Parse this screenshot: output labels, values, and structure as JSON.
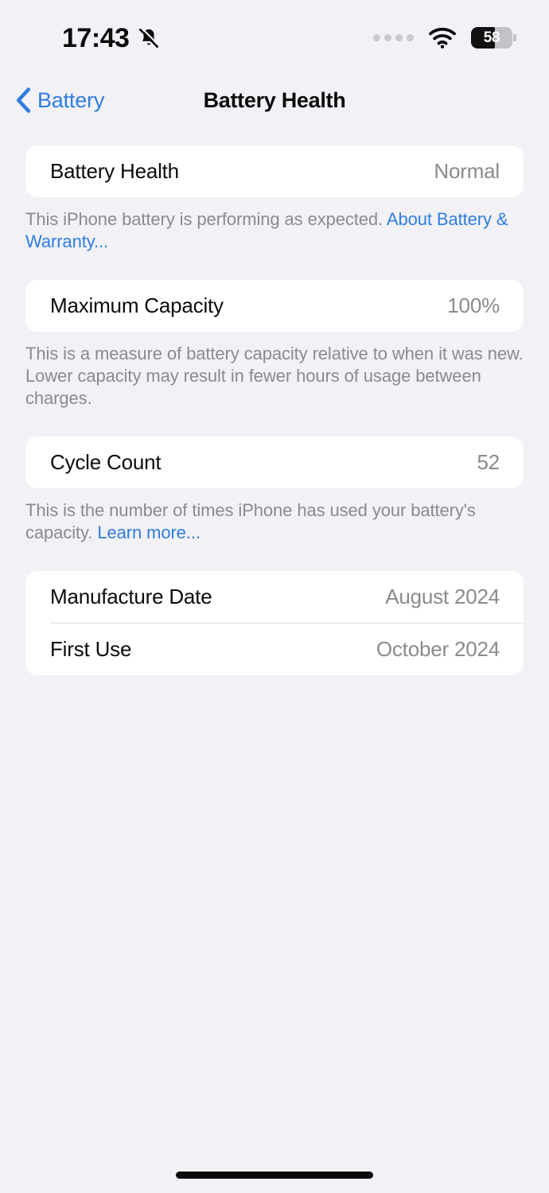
{
  "status_bar": {
    "time": "17:43",
    "silent_icon": "bell-slash-icon",
    "signal_icon": "signal-dots-icon",
    "wifi_icon": "wifi-icon",
    "battery_percent_label": "58",
    "battery_percent_value": 58
  },
  "nav": {
    "back_label": "Battery",
    "back_icon": "chevron-left-icon",
    "title": "Battery Health"
  },
  "sections": {
    "battery_health": {
      "row": {
        "label": "Battery Health",
        "value": "Normal"
      },
      "footer_text": "This iPhone battery is performing as expected. ",
      "footer_link": "About Battery & Warranty..."
    },
    "maximum_capacity": {
      "row": {
        "label": "Maximum Capacity",
        "value": "100%"
      },
      "footer_text": "This is a measure of battery capacity relative to when it was new. Lower capacity may result in fewer hours of usage between charges."
    },
    "cycle_count": {
      "row": {
        "label": "Cycle Count",
        "value": "52"
      },
      "footer_text": "This is the number of times iPhone has used your battery's capacity. ",
      "footer_link": "Learn more..."
    },
    "dates": {
      "rows": [
        {
          "label": "Manufacture Date",
          "value": "August 2024"
        },
        {
          "label": "First Use",
          "value": "October 2024"
        }
      ]
    }
  },
  "colors": {
    "background": "#f2f1f6",
    "card": "#ffffff",
    "accent_blue": "#2f7de1",
    "secondary_text": "#8a8a8f",
    "primary_text": "#0b0b0c"
  },
  "home_indicator": "home-indicator"
}
